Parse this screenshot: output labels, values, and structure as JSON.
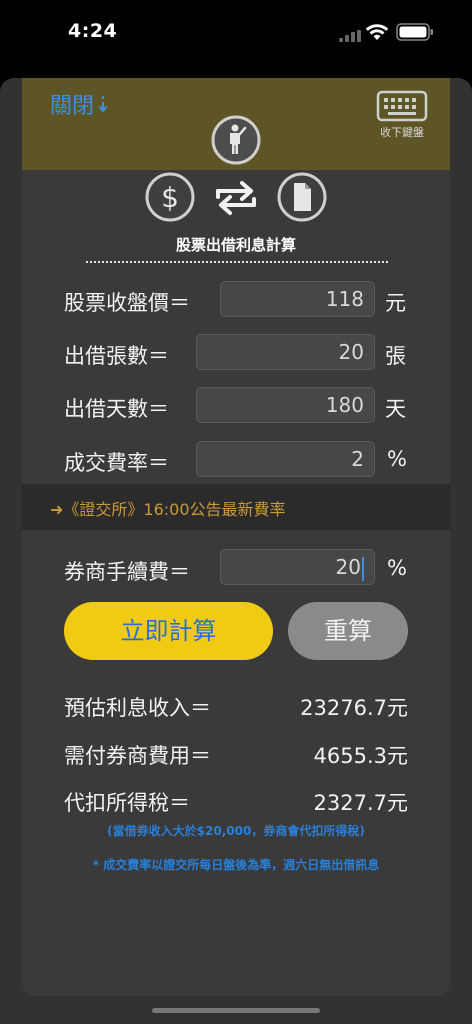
{
  "status": {
    "time": "4:24"
  },
  "header": {
    "close_label": "關閉",
    "keyboard_label": "收下鍵盤"
  },
  "title": "股票出借利息計算",
  "form": {
    "price": {
      "label": "股票收盤價＝",
      "value": "118",
      "unit": "元"
    },
    "shares": {
      "label": "出借張數＝",
      "value": "20",
      "unit": "張"
    },
    "days": {
      "label": "出借天數＝",
      "value": "180",
      "unit": "天"
    },
    "rate": {
      "label": "成交費率＝",
      "value": "2",
      "unit": "%"
    },
    "notice": "➜《證交所》16:00公告最新費率",
    "broker_fee": {
      "label": "券商手續費＝",
      "value": "20",
      "unit": "%"
    }
  },
  "buttons": {
    "calculate": "立即計算",
    "reset": "重算"
  },
  "results": {
    "interest": {
      "label": "預估利息收入＝",
      "value": "23276.7元"
    },
    "broker_cost": {
      "label": "需付券商費用＝",
      "value": "4655.3元"
    },
    "tax": {
      "label": "代扣所得稅＝",
      "value": "2327.7元"
    }
  },
  "notes": {
    "tax_note": "(當借券收入大於$20,000，券商會代扣所得稅)",
    "rate_note": "* 成交費率以證交所每日盤後為準，週六日無出借訊息"
  },
  "colors": {
    "accent_blue": "#3d8fe6",
    "button_yellow": "#f1cb13",
    "notice_orange": "#c9983a"
  }
}
